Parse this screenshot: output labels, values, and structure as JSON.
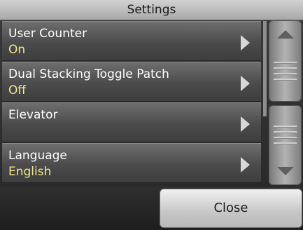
{
  "window": {
    "title": "Settings"
  },
  "settings": {
    "items": [
      {
        "label": "User Counter",
        "value": "On"
      },
      {
        "label": "Dual Stacking Toggle Patch",
        "value": "Off"
      },
      {
        "label": "Elevator",
        "value": ""
      },
      {
        "label": "Language",
        "value": "English"
      }
    ]
  },
  "footer": {
    "close_label": "Close"
  },
  "colors": {
    "value_text": "#f3e58a",
    "title_bar": "#c0c0c0",
    "item_background": "#555555"
  },
  "icons": {
    "item_arrow": "chevron-right-icon",
    "scroll_up": "scroll-up-icon",
    "scroll_down": "scroll-down-icon"
  }
}
